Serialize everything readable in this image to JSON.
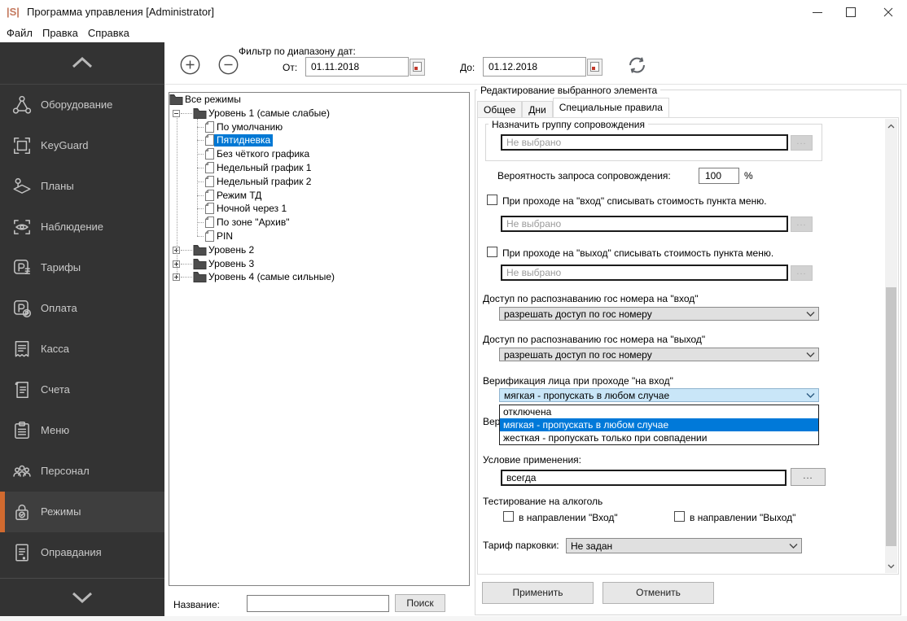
{
  "window": {
    "icon": "|S|",
    "icon_color": "#c4795e",
    "title": "Программа управления [Administrator]"
  },
  "menu": {
    "items": [
      "Файл",
      "Правка",
      "Справка"
    ]
  },
  "toolbar": {
    "filter_label": "Фильтр по диапазону дат:",
    "from_label": "От:",
    "from_value": "01.11.2018",
    "to_label": "До:",
    "to_value": "01.12.2018"
  },
  "sidebar": {
    "accent_color": "#d16a2f",
    "items": [
      {
        "key": "equipment",
        "label": "Оборудование",
        "selected": false
      },
      {
        "key": "keyguard",
        "label": "KeyGuard",
        "selected": false
      },
      {
        "key": "plans",
        "label": "Планы",
        "selected": false
      },
      {
        "key": "surveillance",
        "label": "Наблюдение",
        "selected": false
      },
      {
        "key": "tariffs",
        "label": "Тарифы",
        "selected": false
      },
      {
        "key": "payment",
        "label": "Оплата",
        "selected": false
      },
      {
        "key": "cashier",
        "label": "Касса",
        "selected": false
      },
      {
        "key": "accounts",
        "label": "Счета",
        "selected": false
      },
      {
        "key": "menu",
        "label": "Меню",
        "selected": false
      },
      {
        "key": "staff",
        "label": "Персонал",
        "selected": false
      },
      {
        "key": "modes",
        "label": "Режимы",
        "selected": true
      },
      {
        "key": "excuses",
        "label": "Оправдания",
        "selected": false
      }
    ]
  },
  "tree": {
    "rows": [
      {
        "level": 0,
        "icon": "folder",
        "expander": "",
        "label": "Все режимы",
        "selected": false
      },
      {
        "level": 1,
        "icon": "folder",
        "expander": "minus",
        "label": "Уровень 1 (самые слабые)",
        "selected": false
      },
      {
        "level": 2,
        "icon": "doc",
        "expander": "",
        "label": "По умолчанию",
        "selected": false
      },
      {
        "level": 2,
        "icon": "doc",
        "expander": "",
        "label": "Пятидневка",
        "selected": true
      },
      {
        "level": 2,
        "icon": "doc",
        "expander": "",
        "label": "Без чёткого графика",
        "selected": false
      },
      {
        "level": 2,
        "icon": "doc",
        "expander": "",
        "label": "Недельный график 1",
        "selected": false
      },
      {
        "level": 2,
        "icon": "doc",
        "expander": "",
        "label": "Недельный график 2",
        "selected": false
      },
      {
        "level": 2,
        "icon": "doc",
        "expander": "",
        "label": "Режим ТД",
        "selected": false
      },
      {
        "level": 2,
        "icon": "doc",
        "expander": "",
        "label": "Ночной через 1",
        "selected": false
      },
      {
        "level": 2,
        "icon": "doc",
        "expander": "",
        "label": "По зоне \"Архив\"",
        "selected": false
      },
      {
        "level": 2,
        "icon": "doc",
        "expander": "",
        "label": "PIN",
        "selected": false
      },
      {
        "level": 1,
        "icon": "folder",
        "expander": "plus",
        "label": "Уровень 2",
        "selected": false
      },
      {
        "level": 1,
        "icon": "folder",
        "expander": "plus",
        "label": "Уровень 3",
        "selected": false
      },
      {
        "level": 1,
        "icon": "folder",
        "expander": "plus",
        "label": "Уровень 4 (самые сильные)",
        "selected": false
      }
    ]
  },
  "search": {
    "label": "Название:",
    "value": "",
    "button": "Поиск"
  },
  "editor": {
    "group_title": "Редактирование выбранного элемента",
    "tabs": [
      {
        "label": "Общее",
        "active": false
      },
      {
        "label": "Дни",
        "active": false
      },
      {
        "label": "Специальные правила",
        "active": true
      }
    ],
    "escort_group": {
      "title": "Назначить группу сопровождения",
      "value": "Не выбрано",
      "browse": "..."
    },
    "probability": {
      "label": "Вероятность запроса сопровождения:",
      "value": "100",
      "unit": "%"
    },
    "entry_charge": {
      "label": "При проходе на \"вход\" списывать стоимость пункта меню.",
      "checked": false,
      "value": "Не выбрано",
      "browse": "..."
    },
    "exit_charge": {
      "label": "При проходе на \"выход\" списывать стоимость пункта меню.",
      "checked": false,
      "value": "Не выбрано",
      "browse": "..."
    },
    "plate_entry": {
      "label": "Доступ по распознаванию гос номера на \"вход\"",
      "value": "разрешать доступ по гос номеру"
    },
    "plate_exit": {
      "label": "Доступ по распознаванию гос номера на \"выход\"",
      "value": "разрешать доступ по гос номеру"
    },
    "face_entry": {
      "label": "Верификация лица при проходе \"на вход\"",
      "value": "мягкая - пропускать в любом случае",
      "options": [
        "отключена",
        "мягкая - пропускать в любом случае",
        "жесткая - пропускать только при совпадении"
      ],
      "selected_index": 1
    },
    "face_exit_partial_label": "Вери",
    "condition": {
      "label": "Условие применения:",
      "value": "всегда",
      "browse": "..."
    },
    "alcohol": {
      "label": "Тестирование на алкоголь",
      "entry_label": "в направлении \"Вход\"",
      "exit_label": "в направлении \"Выход\""
    },
    "parking": {
      "label": "Тариф парковки:",
      "value": "Не задан"
    },
    "apply_label": "Применить",
    "cancel_label": "Отменить"
  }
}
